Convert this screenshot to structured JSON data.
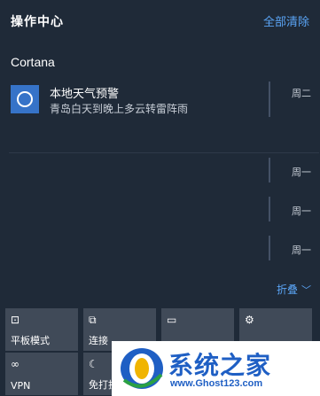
{
  "header": {
    "title": "操作中心",
    "clear_all": "全部清除"
  },
  "section": {
    "app_name": "Cortana"
  },
  "notification": {
    "icon": "cortana-ring-icon",
    "title": "本地天气预警",
    "body": "青岛白天到晚上多云转雷阵雨",
    "day": "周二"
  },
  "older_items": [
    {
      "day": "周一"
    },
    {
      "day": "周一"
    },
    {
      "day": "周一"
    }
  ],
  "collapse_label": "折叠",
  "quick_actions": [
    {
      "label": "平板模式",
      "icon": "tablet-mode-icon",
      "glyph": "⊡"
    },
    {
      "label": "连接",
      "icon": "connect-icon",
      "glyph": "⧉"
    },
    {
      "label": "",
      "icon": "note-icon",
      "glyph": "▭"
    },
    {
      "label": "",
      "icon": "settings-icon",
      "glyph": "⚙"
    },
    {
      "label": "VPN",
      "icon": "vpn-icon",
      "glyph": "∞"
    },
    {
      "label": "免打扰",
      "icon": "moon-icon",
      "glyph": "☾"
    }
  ],
  "watermark": {
    "text": "系统之家",
    "url": "www.Ghost123.com"
  },
  "colors": {
    "background": "#1f2a38",
    "accent": "#5aa4f5",
    "tile": "#404a58",
    "app_tile": "#3673c8"
  }
}
